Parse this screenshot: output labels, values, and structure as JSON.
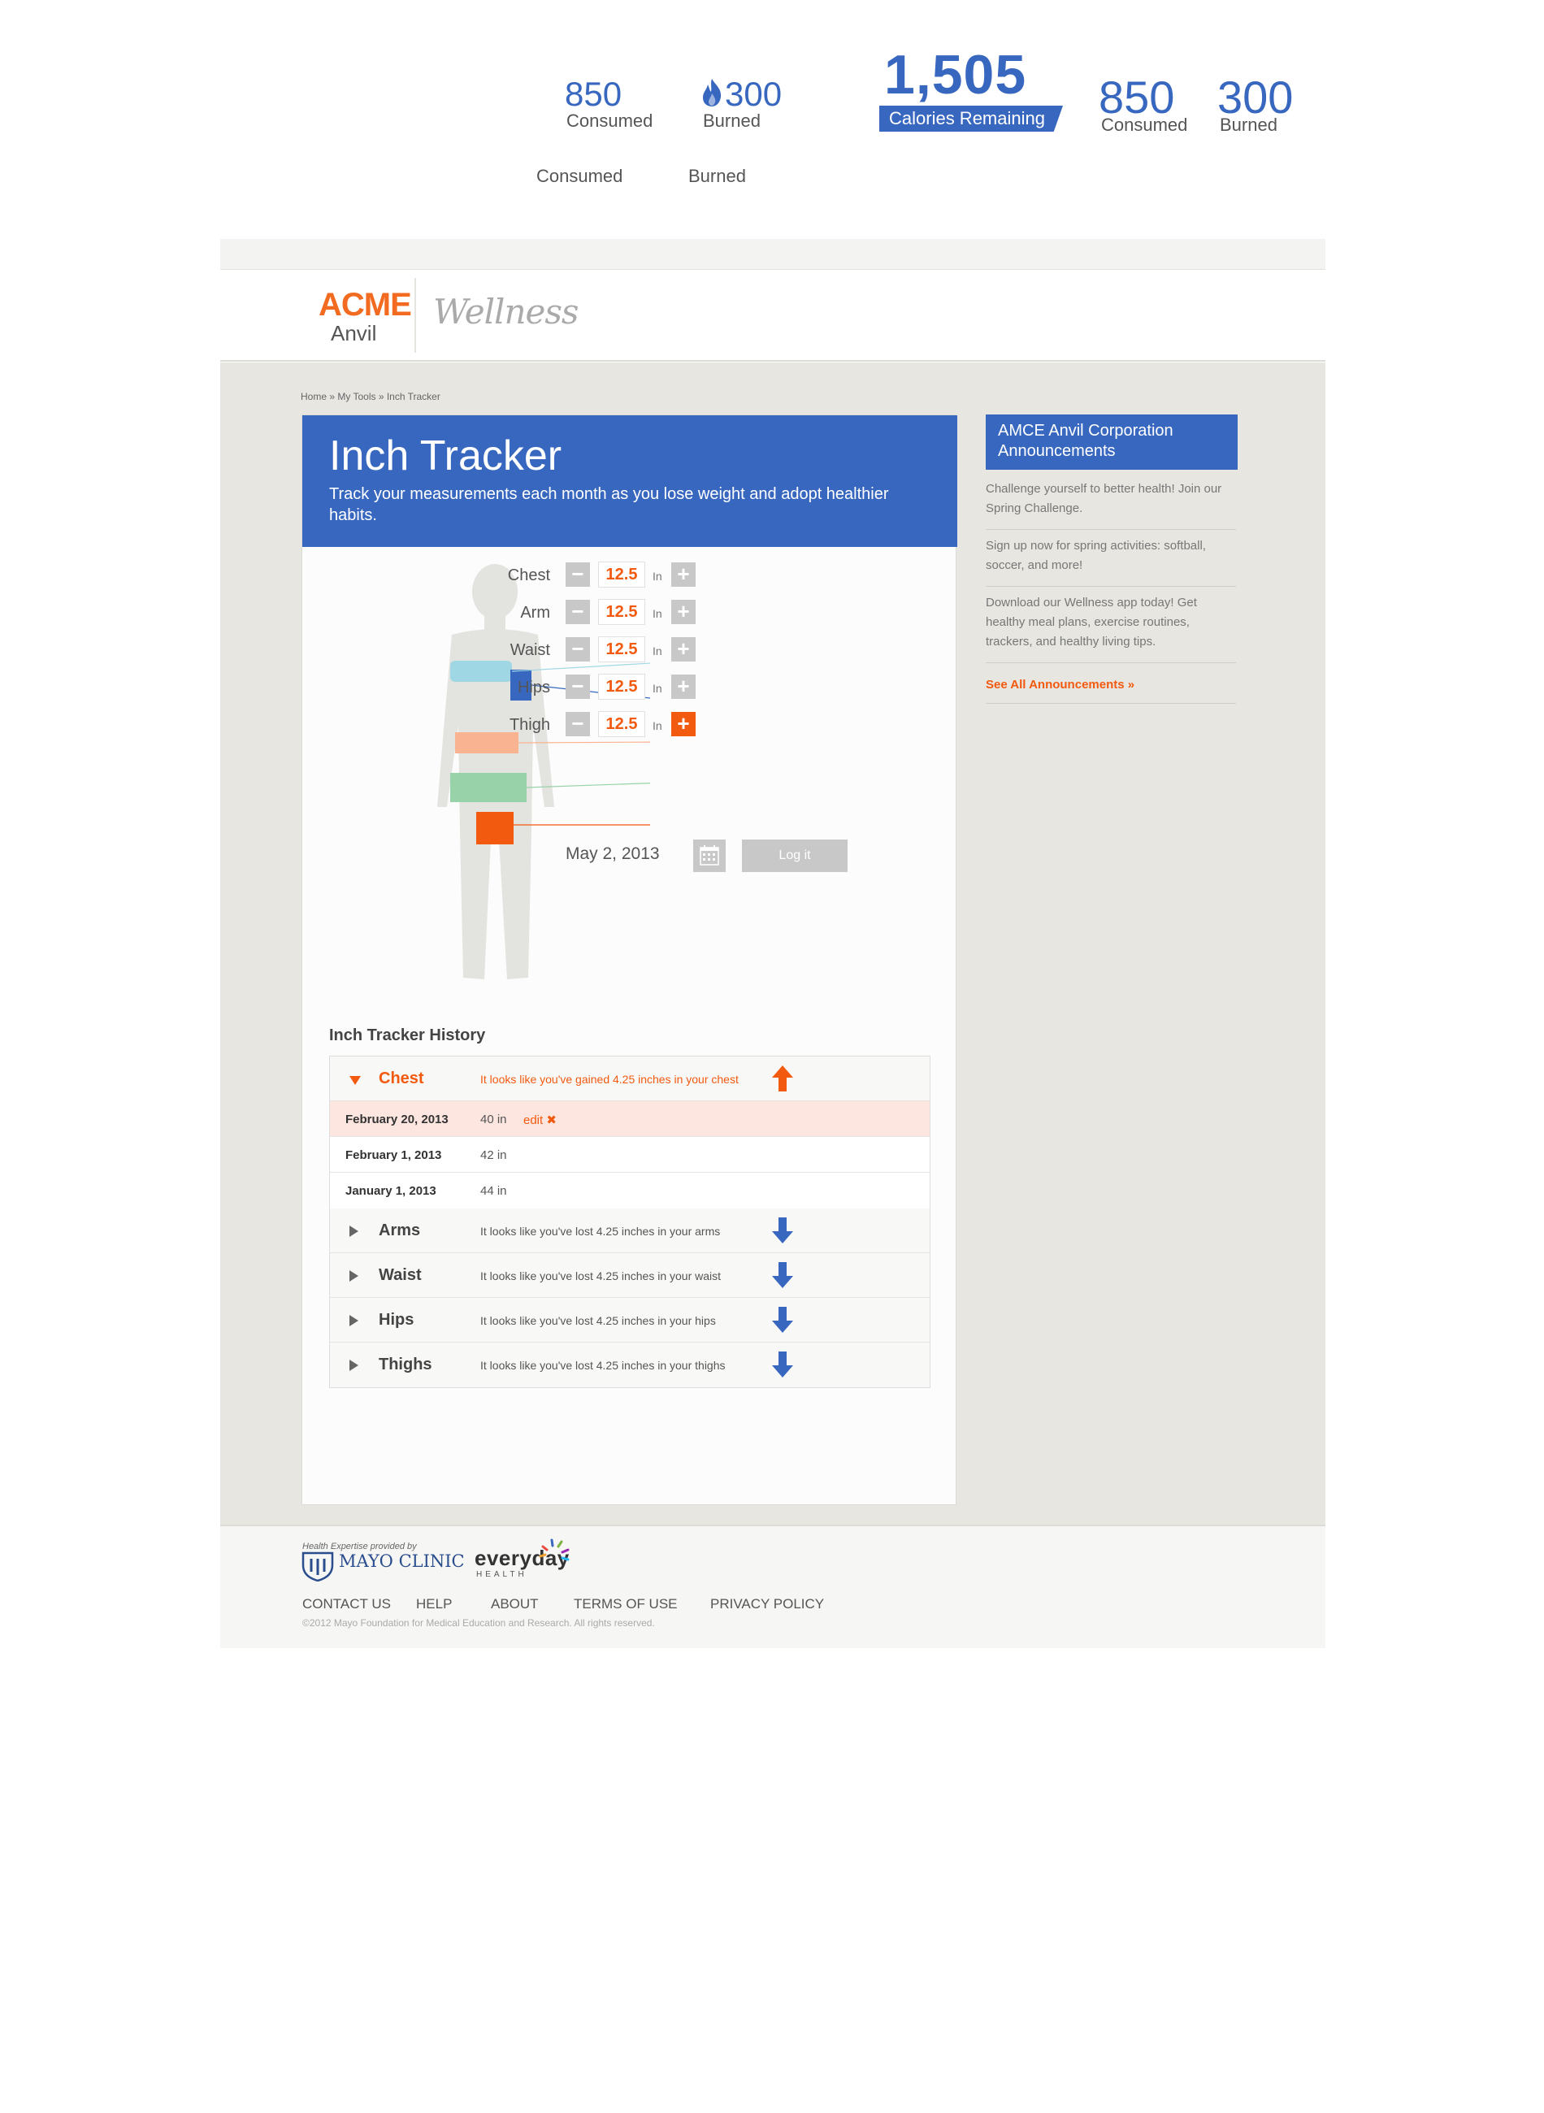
{
  "top_widgets": {
    "small": {
      "consumed_value": "850",
      "consumed_label": "Consumed",
      "burned_value": "300",
      "burned_label": "Burned"
    },
    "loose_labels": {
      "consumed": "Consumed",
      "burned": "Burned"
    },
    "remaining": {
      "value": "1,505",
      "label": "Calories Remaining"
    },
    "large": {
      "consumed_value": "850",
      "consumed_label": "Consumed",
      "burned_value": "300",
      "burned_label": "Burned"
    }
  },
  "brand": {
    "acme": "ACME",
    "anvil": "Anvil",
    "wellness": "Wellness"
  },
  "breadcrumb": "Home » My Tools » Inch Tracker",
  "hero": {
    "title": "Inch Tracker",
    "subtitle": "Track your measurements each month as you lose weight and adopt healthier habits."
  },
  "measurements": [
    {
      "label": "Chest",
      "value": "12.5",
      "unit": "In",
      "plus_active": false
    },
    {
      "label": "Arm",
      "value": "12.5",
      "unit": "In",
      "plus_active": false
    },
    {
      "label": "Waist",
      "value": "12.5",
      "unit": "In",
      "plus_active": false
    },
    {
      "label": "Hips",
      "value": "12.5",
      "unit": "In",
      "plus_active": false
    },
    {
      "label": "Thigh",
      "value": "12.5",
      "unit": "In",
      "plus_active": true
    }
  ],
  "log": {
    "date": "May 2, 2013",
    "button": "Log it"
  },
  "history": {
    "title": "Inch Tracker History",
    "chest": {
      "name": "Chest",
      "message": "It looks like you've gained 4.25 inches in your chest",
      "entries": [
        {
          "date": "February 20, 2013",
          "value": "40 in",
          "edit": "edit ✖"
        },
        {
          "date": "February 1, 2013",
          "value": "42 in"
        },
        {
          "date": "January 1, 2013",
          "value": "44 in"
        }
      ]
    },
    "collapsed": [
      {
        "name": "Arms",
        "message": "It looks like you've lost 4.25 inches in your arms"
      },
      {
        "name": "Waist",
        "message": "It looks like you've lost 4.25 inches in your waist"
      },
      {
        "name": "Hips",
        "message": "It looks like you've lost 4.25 inches in your hips"
      },
      {
        "name": "Thighs",
        "message": "It looks like you've lost 4.25 inches in your thighs"
      }
    ]
  },
  "announcements": {
    "title": "AMCE Anvil Corporation Announcements",
    "items": [
      "Challenge yourself to better health! Join our Spring Challenge.",
      "Sign up now for spring activities: softball, soccer, and more!",
      "Download our Wellness app today! Get healthy meal plans, exercise routines, trackers, and healthy living tips."
    ],
    "see_all": "See All Announcements »"
  },
  "footer": {
    "mayo_tag": "Health Expertise provided by",
    "mayo_name": "MAYO CLINIC",
    "everyday": "everyday",
    "everyday_sub": "HEALTH",
    "links": [
      "CONTACT US",
      "HELP",
      "ABOUT",
      "TERMS OF USE",
      "PRIVACY POLICY"
    ],
    "copyright": "©2012 Mayo Foundation for Medical Education and Research. All rights reserved."
  },
  "colors": {
    "accent_blue": "#3867c0",
    "accent_orange": "#f25a10",
    "brand_orange": "#f26b21"
  }
}
